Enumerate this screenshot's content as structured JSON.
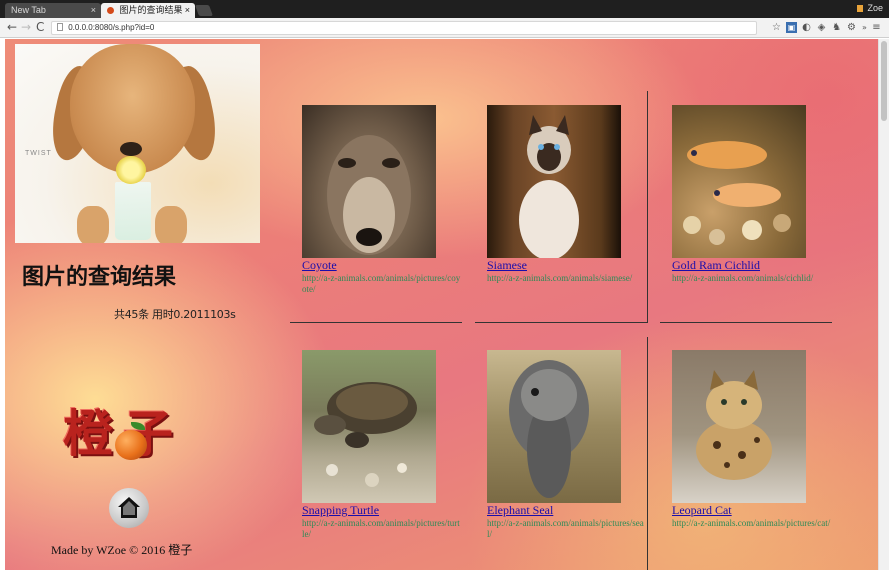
{
  "browser": {
    "tabs": [
      {
        "label": "New Tab",
        "active": false
      },
      {
        "label": "图片的查询结果",
        "active": true
      }
    ],
    "profile_name": "Zoe",
    "address": "0.0.0.0:8080/s.php?id=0",
    "nav": {
      "back": "←",
      "forward": "→",
      "reload": "C"
    }
  },
  "sidebar": {
    "title": "图片的查询结果",
    "stats": "共45条 用时0.2011103s",
    "logo_text": [
      "橙",
      "子"
    ],
    "footer": "Made by WZoe © 2016 橙子"
  },
  "results": [
    {
      "name": "Coyote",
      "url": "http://a-z-animals.com/animals/pictures/coyote/",
      "thumb": "coyote"
    },
    {
      "name": "Siamese",
      "url": "http://a-z-animals.com/animals/siamese/",
      "thumb": "siamese"
    },
    {
      "name": "Gold Ram Cichlid",
      "url": "http://a-z-animals.com/animals/cichlid/",
      "thumb": "fish"
    },
    {
      "name": "Snapping Turtle",
      "url": "http://a-z-animals.com/animals/pictures/turtle/",
      "thumb": "turtle"
    },
    {
      "name": "Elephant Seal",
      "url": "http://a-z-animals.com/animals/pictures/seal/",
      "thumb": "seal"
    },
    {
      "name": "Leopard Cat",
      "url": "http://a-z-animals.com/animals/pictures/cat/",
      "thumb": "leopard"
    }
  ],
  "colors": {
    "link": "#1a0dab",
    "url": "#2e8b57",
    "accent": "#b9231e"
  },
  "icons": {
    "home": "home-icon",
    "star": "star-icon",
    "menu": "menu-icon"
  }
}
